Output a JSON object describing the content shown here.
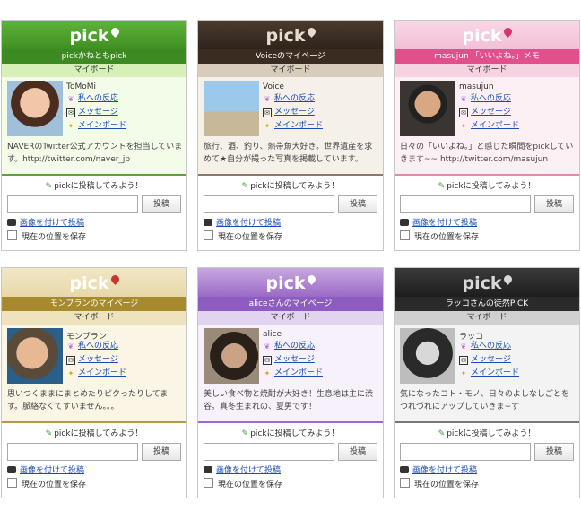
{
  "common": {
    "logo": "pick",
    "subheader": "マイボード",
    "link_reaction": "私への反応",
    "link_message": "メッセージ",
    "link_myboard": "メインボード",
    "post_prompt": "pickに投稿してみよう！",
    "post_button": "投稿",
    "attach_image": "画像を付けて投稿",
    "save_location": "現在の位置を保存"
  },
  "widgets": [
    {
      "title": "pickかねともpick",
      "username": "ToMoMi",
      "bio": "NAVERのTwitter公式アカウントを担当しています。http://twitter.com/naver_jp",
      "theme": "green"
    },
    {
      "title": "Voiceのマイページ",
      "username": "Voice",
      "bio": "旅行、酒、釣り、熱帯魚大好き。世界遺産を求めて★自分が撮った写真を掲載しています。",
      "theme": "brown"
    },
    {
      "title": "masujun 「いいよね。」メモ",
      "username": "masujun",
      "bio": "日々の「いいよね。」と感じた瞬間をpickしていきます~~ http://twitter.com/masujun",
      "theme": "pink"
    },
    {
      "title": "モンブランのマイページ",
      "username": "モンブラン",
      "bio": "思いつくままにまとめたりピクったりしてます。脈絡なくてすいません。。。",
      "theme": "gold"
    },
    {
      "title": "aliceさんのマイページ",
      "username": "alice",
      "bio": "美しい食べ物と焼酎が大好き！生息地は主に渋谷。真冬生まれの、夏男です！",
      "theme": "purple"
    },
    {
      "title": "ラッコさんの徒然PICK",
      "username": "ラッコ",
      "bio": "気になったコト・モノ、日々のよしなしごとをつれづれにアップしていきま~す",
      "theme": "gray"
    }
  ]
}
